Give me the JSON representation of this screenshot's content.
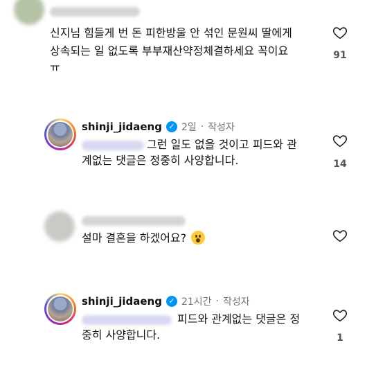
{
  "comments": [
    {
      "lines": [
        "신지님 힘들게 번 돈 피한방울 안 섞인 문원씨 딸에게",
        "상속되는 일 없도록 부부재산약정체결하세요 꼭이요",
        "ㅠ"
      ],
      "likes": "91"
    },
    {
      "username": "shinji_jidaeng",
      "time": "2일",
      "author_label": "작성자",
      "lines": [
        "그런 일도 없을 것이고 피드와 관",
        "계없는 댓글은 정중히 사양합니다."
      ],
      "likes": "14"
    },
    {
      "lines": [
        "설마 결혼을 하겠어요?"
      ],
      "emoji": "hushed-face-emoji",
      "likes": ""
    },
    {
      "username": "shinji_jidaeng",
      "time": "21시간",
      "author_label": "작성자",
      "lines": [
        "피드와 관계없는 댓글은 정",
        "중히 사양합니다."
      ],
      "likes": "1"
    }
  ],
  "separator": "·",
  "icons": {
    "like": "heart-outline-icon",
    "verified": "verified-badge-icon"
  },
  "colors": {
    "verified": "#0095f6",
    "meta": "#737373"
  }
}
